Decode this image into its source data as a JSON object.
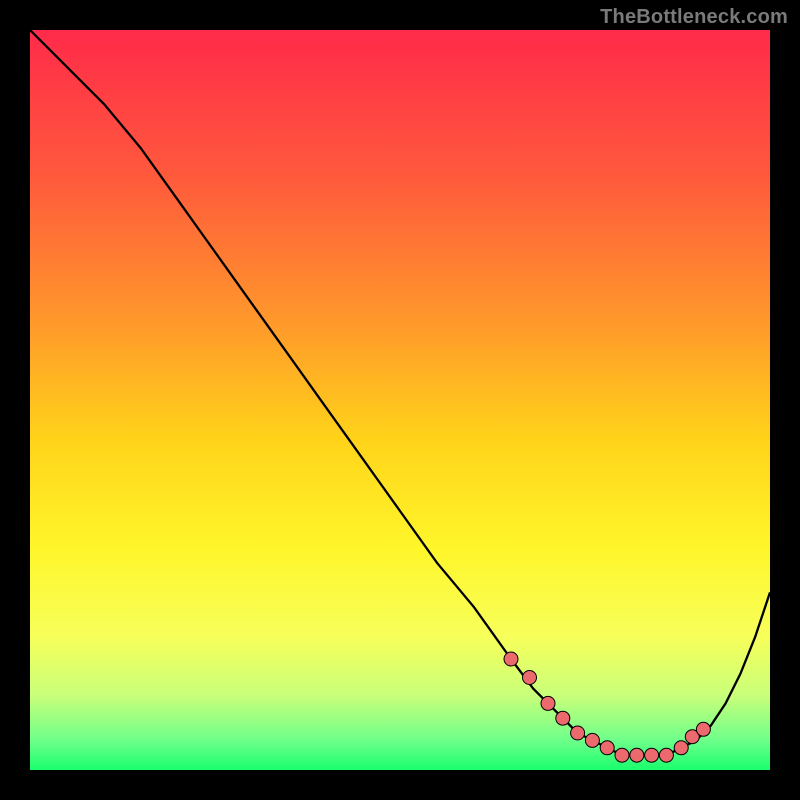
{
  "watermark": "TheBottleneck.com",
  "colors": {
    "background": "#000000",
    "line": "#000000",
    "markers": "#ec6a6e",
    "marker_stroke": "#000000",
    "gradient_stops": [
      {
        "offset": 0.0,
        "color": "#ff2a4a"
      },
      {
        "offset": 0.2,
        "color": "#ff5a3c"
      },
      {
        "offset": 0.4,
        "color": "#ff9a2a"
      },
      {
        "offset": 0.55,
        "color": "#ffd21a"
      },
      {
        "offset": 0.7,
        "color": "#fff62a"
      },
      {
        "offset": 0.82,
        "color": "#f7ff5a"
      },
      {
        "offset": 0.9,
        "color": "#c8ff7a"
      },
      {
        "offset": 0.96,
        "color": "#6eff8a"
      },
      {
        "offset": 1.0,
        "color": "#1aff6e"
      }
    ]
  },
  "chart_data": {
    "type": "line",
    "title": "",
    "xlabel": "",
    "ylabel": "",
    "xlim": [
      0,
      100
    ],
    "ylim": [
      0,
      100
    ],
    "series": [
      {
        "name": "curve",
        "x": [
          0,
          3,
          6,
          10,
          15,
          20,
          25,
          30,
          35,
          40,
          45,
          50,
          55,
          60,
          65,
          68,
          70,
          72,
          74,
          76,
          78,
          80,
          82,
          84,
          86,
          88,
          90,
          92,
          94,
          96,
          98,
          100
        ],
        "y": [
          100,
          97,
          94,
          90,
          84,
          77,
          70,
          63,
          56,
          49,
          42,
          35,
          28,
          22,
          15,
          11,
          9,
          7,
          5,
          4,
          3,
          2,
          2,
          2,
          2,
          3,
          4,
          6,
          9,
          13,
          18,
          24
        ]
      }
    ],
    "markers": {
      "name": "highlight-points",
      "x": [
        65,
        67.5,
        70,
        72,
        74,
        76,
        78,
        80,
        82,
        84,
        86,
        88,
        89.5,
        91
      ],
      "y": [
        15,
        12.5,
        9,
        7,
        5,
        4,
        3,
        2,
        2,
        2,
        2,
        3,
        4.5,
        5.5
      ]
    }
  }
}
